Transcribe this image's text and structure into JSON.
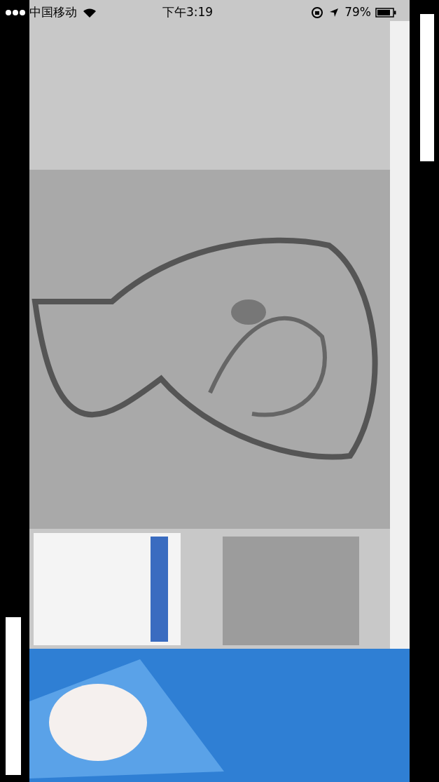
{
  "status_bar": {
    "carrier": "中国移动",
    "time": "下午3:19",
    "battery": "79%"
  }
}
